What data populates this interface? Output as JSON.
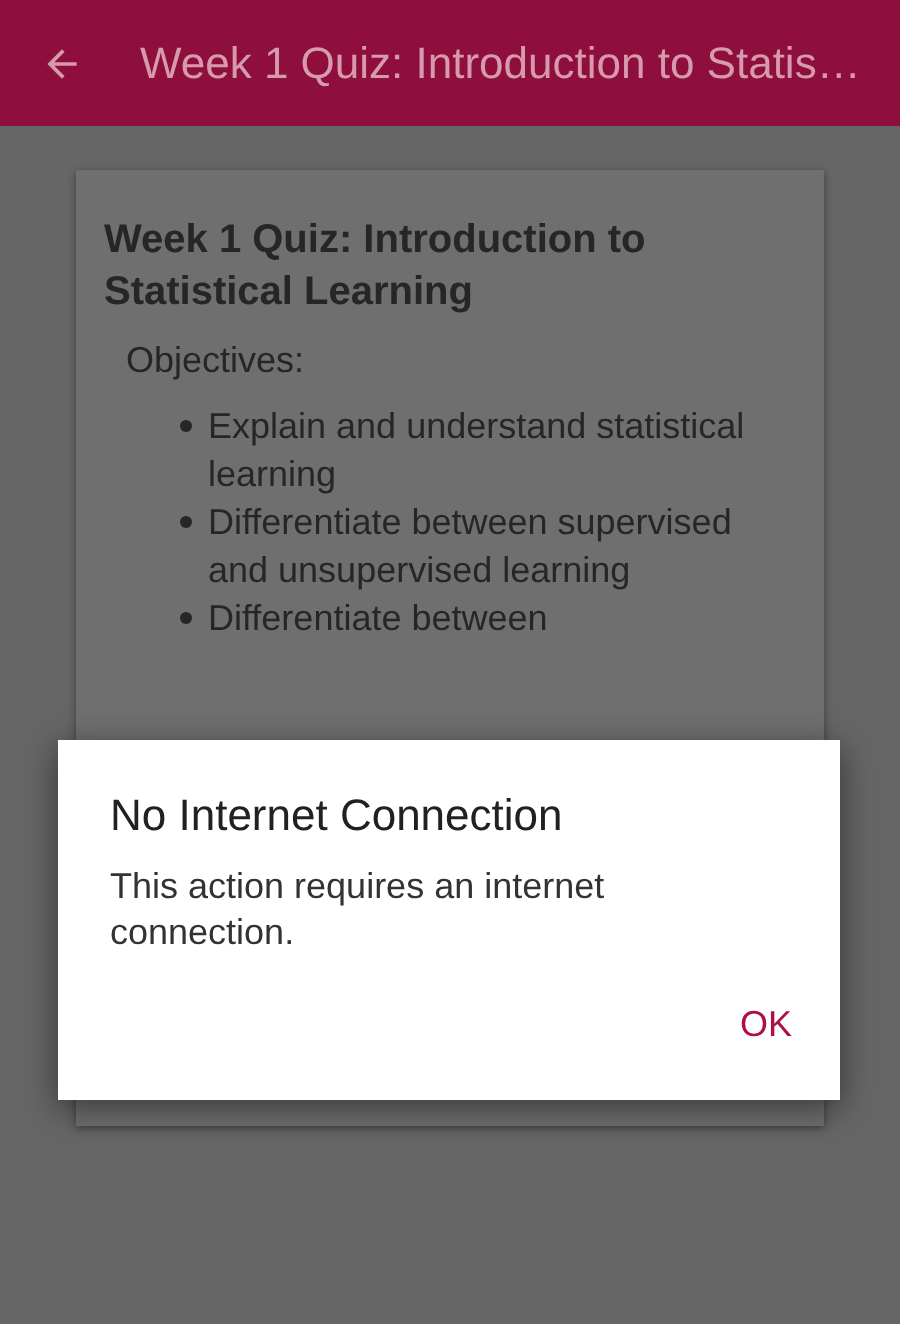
{
  "app_bar": {
    "title": "Week 1 Quiz: Introduction to Statis…"
  },
  "card": {
    "title": "Week 1 Quiz: Introduction to Statistical Learning",
    "section": "Objectives:",
    "objectives": [
      "Explain and understand statistical learning",
      "Differentiate between supervised and unsupervised learning",
      "Differentiate between"
    ]
  },
  "dialog": {
    "title": "No Internet Connection",
    "message": "This action requires an internet connection.",
    "buttons": [
      "OK"
    ]
  }
}
